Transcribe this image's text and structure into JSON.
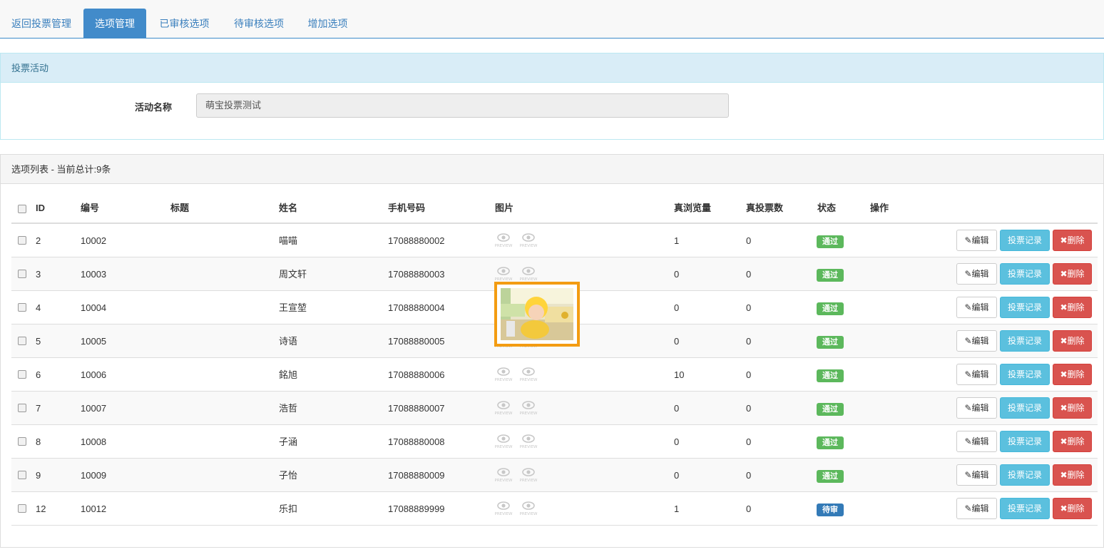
{
  "tabs": [
    "返回投票管理",
    "选项管理",
    "已审核选项",
    "待审核选项",
    "增加选项"
  ],
  "activity_panel": {
    "heading": "投票活动",
    "name_label": "活动名称",
    "name_value": "萌宝投票测试"
  },
  "list_panel": {
    "heading": "选项列表 - 当前总计:9条"
  },
  "table": {
    "headers": {
      "id": "ID",
      "number": "编号",
      "title": "标题",
      "name": "姓名",
      "phone": "手机号码",
      "image": "图片",
      "views": "真浏览量",
      "votes": "真投票数",
      "status": "状态",
      "actions": "操作"
    },
    "rows": [
      {
        "id": "2",
        "number": "10002",
        "title": "",
        "name": "喵喵",
        "phone": "17088880002",
        "views": "1",
        "votes": "0",
        "status": "通过"
      },
      {
        "id": "3",
        "number": "10003",
        "title": "",
        "name": "周文轩",
        "phone": "17088880003",
        "views": "0",
        "votes": "0",
        "status": "通过"
      },
      {
        "id": "4",
        "number": "10004",
        "title": "",
        "name": "王宣堃",
        "phone": "17088880004",
        "views": "0",
        "votes": "0",
        "status": "通过"
      },
      {
        "id": "5",
        "number": "10005",
        "title": "",
        "name": "诗语",
        "phone": "17088880005",
        "views": "0",
        "votes": "0",
        "status": "通过"
      },
      {
        "id": "6",
        "number": "10006",
        "title": "",
        "name": "銘旭",
        "phone": "17088880006",
        "views": "10",
        "votes": "0",
        "status": "通过"
      },
      {
        "id": "7",
        "number": "10007",
        "title": "",
        "name": "浩哲",
        "phone": "17088880007",
        "views": "0",
        "votes": "0",
        "status": "通过"
      },
      {
        "id": "8",
        "number": "10008",
        "title": "",
        "name": "子涵",
        "phone": "17088880008",
        "views": "0",
        "votes": "0",
        "status": "通过"
      },
      {
        "id": "9",
        "number": "10009",
        "title": "",
        "name": "子怡",
        "phone": "17088880009",
        "views": "0",
        "votes": "0",
        "status": "通过"
      },
      {
        "id": "12",
        "number": "10012",
        "title": "",
        "name": "乐扣",
        "phone": "17088889999",
        "views": "1",
        "votes": "0",
        "status": "待审"
      }
    ],
    "buttons": {
      "edit": "✎编辑",
      "log": "投票记录",
      "delete": "✖删除"
    },
    "preview_text": "PREVIEW"
  },
  "colors": {
    "primary": "#428bca",
    "success": "#5cb85c",
    "info": "#5bc0de",
    "danger": "#d9534f",
    "pending": "#337ab7",
    "preview_border": "#f39c12"
  }
}
